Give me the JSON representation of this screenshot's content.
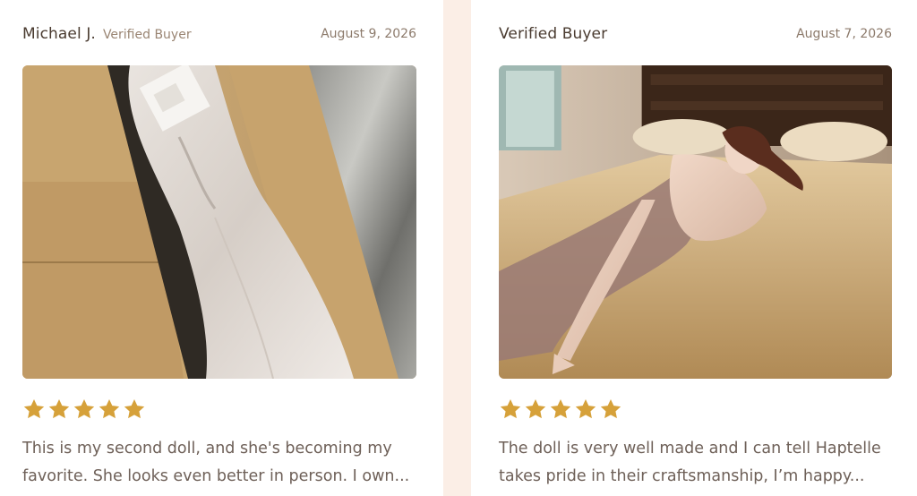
{
  "colors": {
    "page_background": "#fbeee6",
    "card_background": "#ffffff",
    "star": "#d6a13a",
    "name_text": "#4a3b30",
    "muted_text": "#8c7a6b",
    "body_text": "#6e6058"
  },
  "icons": {
    "rating_star": "star-icon"
  },
  "reviews": [
    {
      "name": "Michael J.",
      "badge": "Verified Buyer",
      "date": "August 9, 2026",
      "rating": 5,
      "photo_subject": "doll wrapped in white cloth inside cardboard shipping box",
      "text_lines": [
        "This is my second doll, and she's becoming my",
        "favorite. She looks even better in person. I own..."
      ]
    },
    {
      "name": "Verified Buyer",
      "badge": "",
      "date": "August 7, 2026",
      "rating": 5,
      "photo_subject": "doll lying on a bed in a bedroom",
      "text_lines": [
        "The doll is very well made and I can tell Haptelle",
        "takes pride in their craftsmanship, I’m happy..."
      ]
    }
  ]
}
